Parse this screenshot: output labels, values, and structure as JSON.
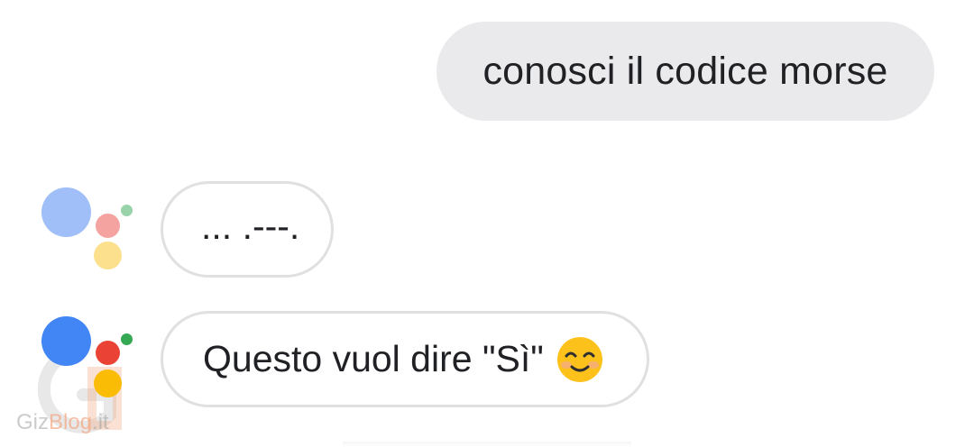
{
  "conversation": {
    "user_message": "conosci il codice morse",
    "assistant_messages": [
      {
        "text": "... .---."
      },
      {
        "text": "Questo vuol dire \"Sì\"",
        "emoji": "smiling-face-emoji"
      }
    ]
  },
  "watermark": {
    "brand_part": "Giz",
    "accent_part": "Blog",
    "suffix": ".it"
  },
  "colors": {
    "user_bubble_bg": "#eaeaed",
    "bubble_border": "#e0e0e0",
    "text": "#202124",
    "google_blue": "#4285f4",
    "google_red": "#ea4335",
    "google_yellow": "#fbbc05",
    "google_green": "#34a853"
  },
  "icons": {
    "assistant_logo": "google-assistant-icon",
    "emoji": "smiling-face-emoji"
  }
}
